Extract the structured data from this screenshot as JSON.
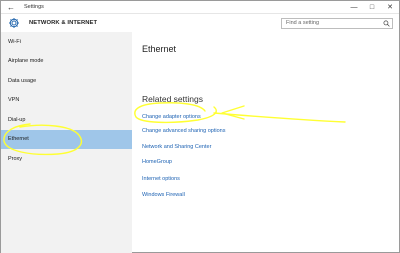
{
  "window": {
    "title": "Settings",
    "back_icon": "back-arrow-icon",
    "controls": [
      "—",
      "□",
      "✕"
    ]
  },
  "header": {
    "title": "NETWORK & INTERNET",
    "icon": "gear-icon",
    "search_placeholder": "Find a setting",
    "search_icon": "search-icon"
  },
  "sidebar": {
    "items": [
      {
        "label": "Wi-Fi"
      },
      {
        "label": "Airplane mode"
      },
      {
        "label": "Data usage"
      },
      {
        "label": "VPN"
      },
      {
        "label": "Dial-up"
      },
      {
        "label": "Ethernet",
        "active": true
      },
      {
        "label": "Proxy"
      }
    ]
  },
  "main": {
    "title": "Ethernet",
    "related_title": "Related settings",
    "links": [
      "Change adapter options",
      "Change advanced sharing options",
      "Network and Sharing Center",
      "HomeGroup",
      "Internet options",
      "Windows Firewall"
    ]
  },
  "annotations": {
    "color": "#ffff33"
  }
}
